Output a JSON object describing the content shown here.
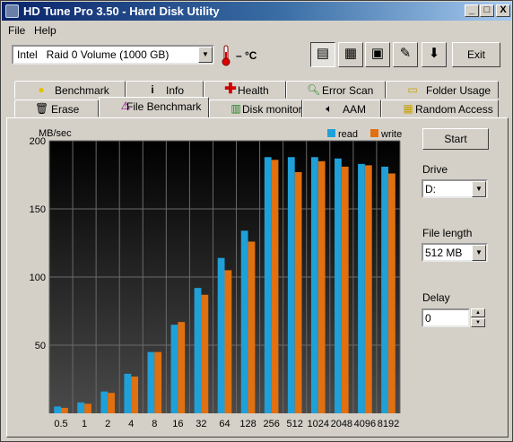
{
  "window": {
    "title": "HD Tune Pro 3.50 - Hard Disk Utility",
    "controls": {
      "minimize": "_",
      "maximize": "□",
      "close": "X"
    }
  },
  "menu": {
    "items": [
      {
        "label": "File"
      },
      {
        "label": "Help"
      }
    ]
  },
  "toolbar": {
    "drive_select": "Intel   Raid 0 Volume (1000 GB)",
    "temperature": "– °C",
    "buttons": [
      {
        "name": "copy-text-icon",
        "glyph": "▤"
      },
      {
        "name": "copy-screenshot-icon",
        "glyph": "▦"
      },
      {
        "name": "save-icon",
        "glyph": "▣"
      },
      {
        "name": "options-icon",
        "glyph": "✎"
      },
      {
        "name": "download-icon",
        "glyph": "⬇"
      }
    ],
    "exit_label": "Exit"
  },
  "tabs": {
    "row1": [
      {
        "label": "Benchmark",
        "icon": "benchmark-icon"
      },
      {
        "label": "Info",
        "icon": "info-icon"
      },
      {
        "label": "Health",
        "icon": "health-icon"
      },
      {
        "label": "Error Scan",
        "icon": "error-scan-icon"
      },
      {
        "label": "Folder Usage",
        "icon": "folder-icon"
      }
    ],
    "row2": [
      {
        "label": "Erase",
        "icon": "erase-icon"
      },
      {
        "label": "File Benchmark",
        "icon": "file-benchmark-icon",
        "active": true
      },
      {
        "label": "Disk monitor",
        "icon": "disk-monitor-icon"
      },
      {
        "label": "AAM",
        "icon": "aam-icon"
      },
      {
        "label": "Random Access",
        "icon": "random-access-icon"
      }
    ]
  },
  "side_panel": {
    "start_label": "Start",
    "drive_label": "Drive",
    "drive_value": "D:",
    "file_length_label": "File length",
    "file_length_value": "512 MB",
    "delay_label": "Delay",
    "delay_value": "0"
  },
  "chart_data": {
    "type": "bar",
    "ylabel": "MB/sec",
    "ylim": [
      0,
      200
    ],
    "yticks": [
      50,
      100,
      150,
      200
    ],
    "categories": [
      "0.5",
      "1",
      "2",
      "4",
      "8",
      "16",
      "32",
      "64",
      "128",
      "256",
      "512",
      "1024",
      "2048",
      "4096",
      "8192"
    ],
    "series": [
      {
        "name": "read",
        "color": "#1fa0d8",
        "values": [
          5,
          8,
          16,
          29,
          45,
          65,
          92,
          114,
          134,
          188,
          188,
          188,
          187,
          183,
          181
        ]
      },
      {
        "name": "write",
        "color": "#e07010",
        "values": [
          4,
          7,
          15,
          27,
          45,
          67,
          87,
          105,
          126,
          186,
          177,
          185,
          181,
          182,
          176
        ]
      }
    ],
    "legend_position": "top-right",
    "grid": true
  }
}
